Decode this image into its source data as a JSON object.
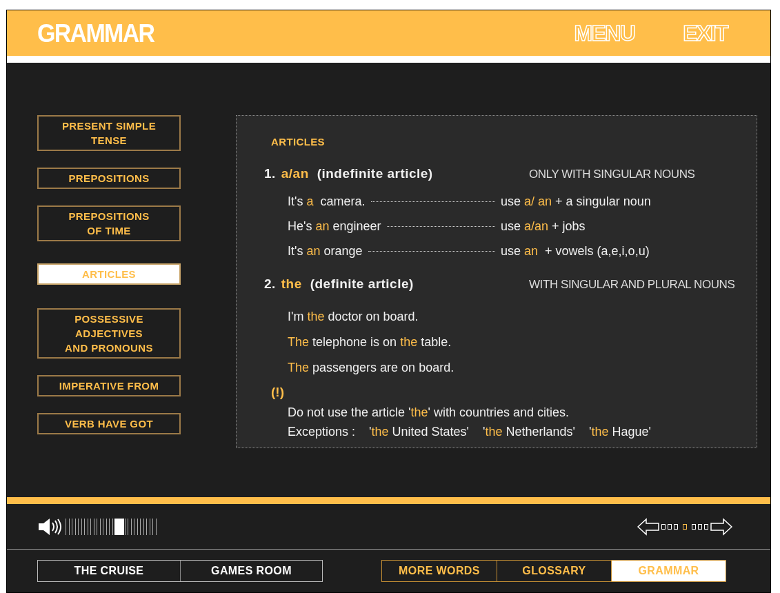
{
  "header": {
    "title": "GRAMMAR",
    "links": [
      "MENU",
      "EXIT"
    ]
  },
  "sidebar": {
    "items": [
      {
        "label": "PRESENT SIMPLE\nTENSE",
        "selected": false
      },
      {
        "label": "PREPOSITIONS",
        "selected": false
      },
      {
        "label": "PREPOSITIONS\nOF TIME",
        "selected": false
      },
      {
        "label": "ARTICLES",
        "selected": true
      },
      {
        "label": "POSSESSIVE\nADJECTIVES\nAND PRONOUNS",
        "selected": false
      },
      {
        "label": "IMPERATIVE FROM",
        "selected": false
      },
      {
        "label": "VERB HAVE GOT",
        "selected": false
      }
    ]
  },
  "content": {
    "title": "ARTICLES",
    "sections": [
      {
        "number": "1.",
        "term": "a/an",
        "description": "(indefinite article)",
        "note": "ONLY WITH SINGULAR NOUNS",
        "kind": "examples",
        "examples": [
          {
            "sentence": [
              {
                "text": "It's ",
                "highlight": false
              },
              {
                "text": "a",
                "highlight": true
              },
              {
                "text": "  camera.",
                "highlight": false
              }
            ],
            "rule": [
              {
                "text": "use ",
                "highlight": false
              },
              {
                "text": "a/ an",
                "highlight": true
              },
              {
                "text": " + a singular noun",
                "highlight": false
              }
            ]
          },
          {
            "sentence": [
              {
                "text": "He's ",
                "highlight": false
              },
              {
                "text": "an",
                "highlight": true
              },
              {
                "text": " engineer",
                "highlight": false
              }
            ],
            "rule": [
              {
                "text": "use ",
                "highlight": false
              },
              {
                "text": "a/an",
                "highlight": true
              },
              {
                "text": " + jobs",
                "highlight": false
              }
            ]
          },
          {
            "sentence": [
              {
                "text": "It's ",
                "highlight": false
              },
              {
                "text": "an",
                "highlight": true
              },
              {
                "text": " orange",
                "highlight": false
              }
            ],
            "rule": [
              {
                "text": "use ",
                "highlight": false
              },
              {
                "text": "an",
                "highlight": true
              },
              {
                "text": "  + vowels (a,e,i,o,u)",
                "highlight": false
              }
            ]
          }
        ]
      },
      {
        "number": "2.",
        "term": "the",
        "description": "(definite article)",
        "note": "WITH SINGULAR AND PLURAL NOUNS",
        "kind": "sentences",
        "sentences": [
          [
            {
              "text": "I'm ",
              "highlight": false
            },
            {
              "text": "the",
              "highlight": true
            },
            {
              "text": " doctor on board.",
              "highlight": false
            }
          ],
          [
            {
              "text": "The",
              "highlight": true
            },
            {
              "text": " telephone is on ",
              "highlight": false
            },
            {
              "text": "the",
              "highlight": true
            },
            {
              "text": " table.",
              "highlight": false
            }
          ],
          [
            {
              "text": "The",
              "highlight": true
            },
            {
              "text": " passengers are on board.",
              "highlight": false
            }
          ]
        ]
      }
    ],
    "warning": {
      "mark": "(!)",
      "lines": [
        [
          {
            "text": "Do not use the article '",
            "highlight": false
          },
          {
            "text": "the",
            "highlight": true
          },
          {
            "text": "' with countries and cities.",
            "highlight": false
          }
        ],
        [
          {
            "text": "Exceptions :    '",
            "highlight": false
          },
          {
            "text": "the",
            "highlight": true
          },
          {
            "text": " United States'    '",
            "highlight": false
          },
          {
            "text": "the",
            "highlight": true
          },
          {
            "text": " Netherlands'    '",
            "highlight": false
          },
          {
            "text": "the",
            "highlight": true
          },
          {
            "text": " Hague'",
            "highlight": false
          }
        ]
      ]
    }
  },
  "volume": {
    "level": 0.6
  },
  "pager": {
    "pages": [
      {
        "selected": false
      },
      {
        "selected": false
      },
      {
        "selected": false
      },
      {
        "selected": true
      },
      {
        "selected": false
      },
      {
        "selected": false
      },
      {
        "selected": false
      }
    ]
  },
  "nav": {
    "left": [
      {
        "label": "THE CRUISE",
        "selected": false
      },
      {
        "label": "GAMES ROOM",
        "selected": false
      }
    ],
    "right": [
      {
        "label": "MORE WORDS",
        "selected": false
      },
      {
        "label": "GLOSSARY",
        "selected": false
      },
      {
        "label": "GRAMMAR",
        "selected": true
      }
    ]
  }
}
